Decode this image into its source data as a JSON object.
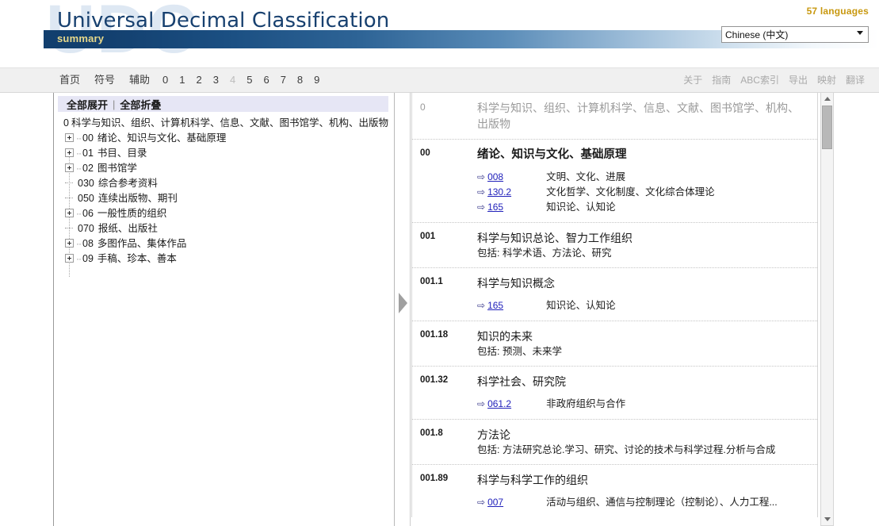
{
  "header": {
    "watermark": "UDC",
    "title": "Universal Decimal Classification",
    "subtitle": "summary",
    "languages_count": "57 languages",
    "language_selected": "Chinese (中文)",
    "language_options": [
      "Chinese (中文)"
    ]
  },
  "nav": {
    "left": [
      {
        "label": "首页",
        "type": "word",
        "disabled": false
      },
      {
        "label": "符号",
        "type": "word",
        "disabled": false
      },
      {
        "label": "辅助",
        "type": "word",
        "disabled": false
      },
      {
        "label": "0",
        "type": "num",
        "disabled": false
      },
      {
        "label": "1",
        "type": "num",
        "disabled": false
      },
      {
        "label": "2",
        "type": "num",
        "disabled": false
      },
      {
        "label": "3",
        "type": "num",
        "disabled": false
      },
      {
        "label": "4",
        "type": "num",
        "disabled": true
      },
      {
        "label": "5",
        "type": "num",
        "disabled": false
      },
      {
        "label": "6",
        "type": "num",
        "disabled": false
      },
      {
        "label": "7",
        "type": "num",
        "disabled": false
      },
      {
        "label": "8",
        "type": "num",
        "disabled": false
      },
      {
        "label": "9",
        "type": "num",
        "disabled": false
      }
    ],
    "right": [
      {
        "label": "关于"
      },
      {
        "label": "指南"
      },
      {
        "label": "ABC索引"
      },
      {
        "label": "导出"
      },
      {
        "label": "映射"
      },
      {
        "label": "翻译"
      }
    ]
  },
  "tree": {
    "expand_all": "全部展开",
    "separator": "|",
    "collapse_all": "全部折叠",
    "root": {
      "code": "0",
      "label": "科学与知识、组织、计算机科学、信息、文献、图书馆学、机构、出版物"
    },
    "nodes": [
      {
        "code": "00",
        "label": "绪论、知识与文化、基础原理",
        "expandable": true
      },
      {
        "code": "01",
        "label": "书目、目录",
        "expandable": true
      },
      {
        "code": "02",
        "label": "图书馆学",
        "expandable": true
      },
      {
        "code": "030",
        "label": "综合参考资料",
        "expandable": false
      },
      {
        "code": "050",
        "label": "连续出版物、期刊",
        "expandable": false
      },
      {
        "code": "06",
        "label": "一般性质的组织",
        "expandable": true
      },
      {
        "code": "070",
        "label": "报纸、出版社",
        "expandable": false
      },
      {
        "code": "08",
        "label": "多图作品、集体作品",
        "expandable": true
      },
      {
        "code": "09",
        "label": "手稿、珍本、善本",
        "expandable": true
      }
    ]
  },
  "records": [
    {
      "code": "0",
      "title": "科学与知识、组织、计算机科学、信息、文献、图书馆学、机构、出版物",
      "header": true,
      "bold": false,
      "includes": "",
      "see_also": []
    },
    {
      "code": "00",
      "title": "绪论、知识与文化、基础原理",
      "header": false,
      "bold": true,
      "includes": "",
      "see_also": [
        {
          "arrow": "⇨",
          "code": "008",
          "text": "文明、文化、进展"
        },
        {
          "arrow": "⇨",
          "code": "130.2",
          "text": "文化哲学、文化制度、文化综合体理论"
        },
        {
          "arrow": "⇨",
          "code": "165",
          "text": "知识论、认知论"
        }
      ]
    },
    {
      "code": "001",
      "title": "科学与知识总论、智力工作组织",
      "header": false,
      "bold": false,
      "includes": "包括: 科学术语、方法论、研究",
      "see_also": []
    },
    {
      "code": "001.1",
      "title": "科学与知识概念",
      "header": false,
      "bold": false,
      "includes": "",
      "see_also": [
        {
          "arrow": "⇨",
          "code": "165",
          "text": "知识论、认知论"
        }
      ]
    },
    {
      "code": "001.18",
      "title": "知识的未来",
      "header": false,
      "bold": false,
      "includes": "包括: 预测、未来学",
      "see_also": []
    },
    {
      "code": "001.32",
      "title": "科学社会、研究院",
      "header": false,
      "bold": false,
      "includes": "",
      "see_also": [
        {
          "arrow": "⇨",
          "code": "061.2",
          "text": "非政府组织与合作"
        }
      ]
    },
    {
      "code": "001.8",
      "title": "方法论",
      "header": false,
      "bold": false,
      "includes": "包括: 方法研究总论.学习、研究、讨论的技术与科学过程.分析与合成",
      "see_also": []
    },
    {
      "code": "001.89",
      "title": "科学与科学工作的组织",
      "header": false,
      "bold": false,
      "includes": "",
      "see_also": [
        {
          "arrow": "⇨",
          "code": "007",
          "text": "活动与组织、通信与控制理论（控制论）、人力工程..."
        }
      ]
    }
  ],
  "colors": {
    "brand_navy": "#123f6e",
    "subtitle_gold": "#e8d98a",
    "lang_count_gold": "#c8980f",
    "link_blue": "#2222bb",
    "watermark": "#dde7f3"
  }
}
